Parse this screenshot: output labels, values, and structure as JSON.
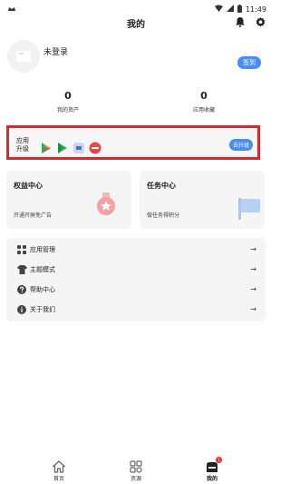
{
  "status_bar": {
    "time": "11:49"
  },
  "header": {
    "title": "我的"
  },
  "profile": {
    "username": "未登录",
    "checkin_label": "签到"
  },
  "stats": [
    {
      "value": "0",
      "label": "我的资产"
    },
    {
      "value": "0",
      "label": "应用收藏"
    }
  ],
  "upgrade": {
    "label": "应用升级",
    "button_label": "去升级",
    "apps": [
      "google-play-icon",
      "play-store-icon",
      "app-icon",
      "red-app-icon"
    ]
  },
  "cards": [
    {
      "title": "权益中心",
      "subtitle": "开通开屏免广告"
    },
    {
      "title": "任务中心",
      "subtitle": "做任务得积分"
    }
  ],
  "menu": [
    {
      "label": "应用管理",
      "icon": "apps-grid-icon"
    },
    {
      "label": "主题模式",
      "icon": "shirt-icon"
    },
    {
      "label": "帮助中心",
      "icon": "help-icon"
    },
    {
      "label": "关于我们",
      "icon": "info-icon"
    }
  ],
  "menu_arrow": "→",
  "bottom_nav": [
    {
      "label": "首页",
      "icon": "home-icon"
    },
    {
      "label": "资源",
      "icon": "resources-icon"
    },
    {
      "label": "我的",
      "icon": "profile-icon",
      "active": true,
      "badge": "1"
    }
  ],
  "colors": {
    "accent": "#4a8df0",
    "highlight_border": "#d42a2a",
    "card_bg": "#f5f5f5"
  }
}
